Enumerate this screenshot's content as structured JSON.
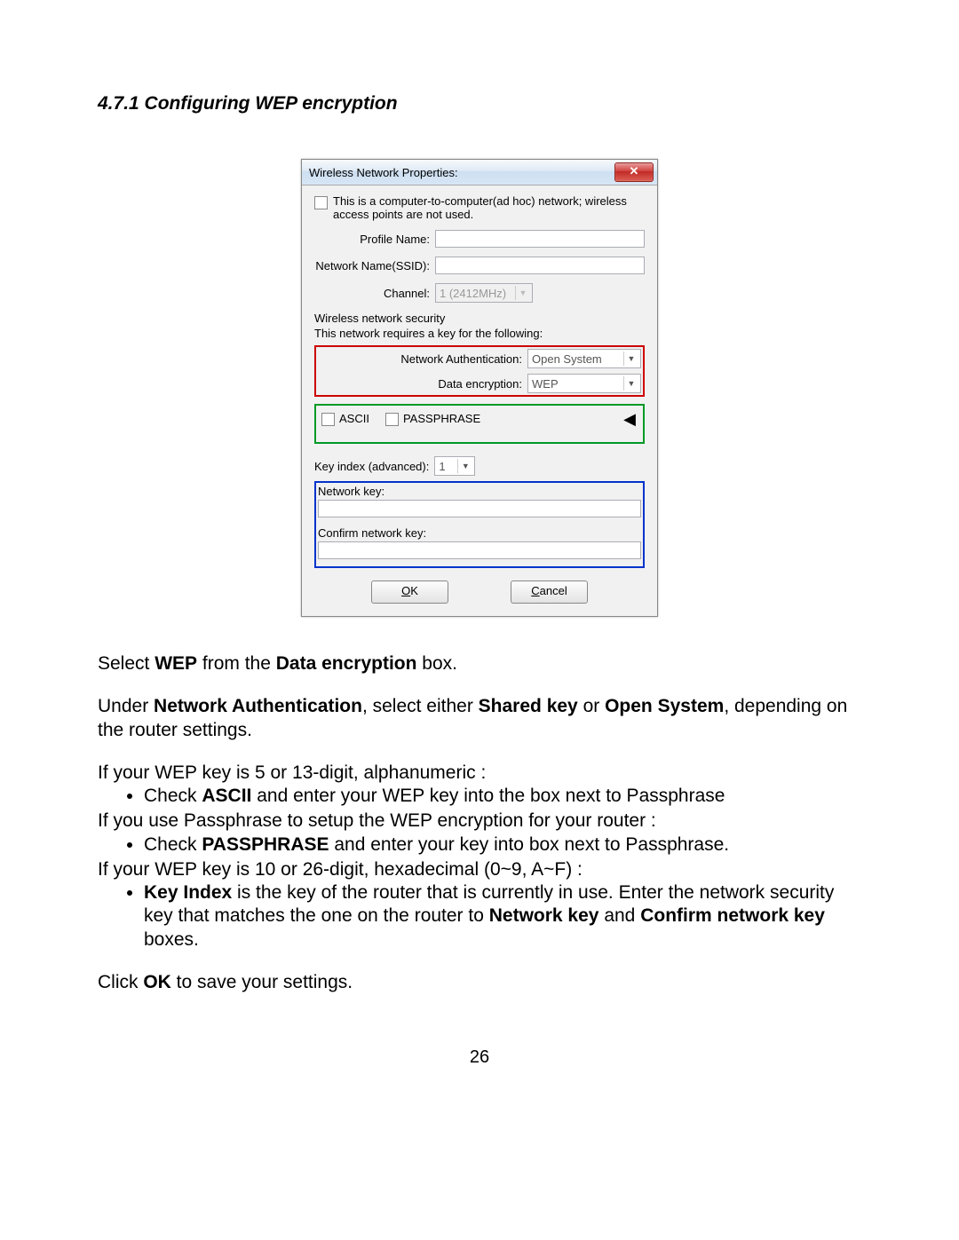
{
  "section_title": "4.7.1 Configuring WEP encryption",
  "dialog": {
    "title": "Wireless Network Properties:",
    "close": "✕",
    "adhoc_text": "This is a computer-to-computer(ad hoc) network; wireless access points are not used.",
    "profile_label": "Profile Name:",
    "ssid_label": "Network Name(SSID):",
    "channel_label": "Channel:",
    "channel_value": "1 (2412MHz)",
    "sec_group": "Wireless network security",
    "sec_sub": "This network requires a key for the following:",
    "auth_label": "Network Authentication:",
    "auth_value": "Open System",
    "enc_label": "Data encryption:",
    "enc_value": "WEP",
    "ascii": "ASCII",
    "passphrase": "PASSPHRASE",
    "key_index_label": "Key index (advanced):",
    "key_index_value": "1",
    "net_key_label": "Network key:",
    "confirm_key_label": "Confirm network key:",
    "ok": "OK",
    "cancel": "Cancel"
  },
  "body": {
    "p1a": "Select ",
    "p1b": "WEP",
    "p1c": " from the ",
    "p1d": "Data encryption",
    "p1e": " box.",
    "p2a": "Under ",
    "p2b": "Network Authentication",
    "p2c": ", select either ",
    "p2d": "Shared key",
    "p2e": " or ",
    "p2f": "Open System",
    "p2g": ", depending on the router settings.",
    "p3": "If your WEP key is 5 or 13-digit, alphanumeric :",
    "b1a": "Check ",
    "b1b": "ASCII",
    "b1c": " and enter your WEP key into the box next to Passphrase",
    "p4": "If you use Passphrase to setup the WEP encryption for your router :",
    "b2a": "Check ",
    "b2b": "PASSPHRASE",
    "b2c": " and enter your key into box next to Passphrase.",
    "p5": "If your WEP key is 10 or 26-digit, hexadecimal (0~9, A~F) :",
    "b3a": "Key Index",
    "b3b": " is the key of the router that is currently in use. Enter the network security key that matches the one on the router to ",
    "b3c": "Network key",
    "b3d": " and ",
    "b3e": "Confirm network key",
    "b3f": " boxes.",
    "p6a": "Click ",
    "p6b": "OK",
    "p6c": " to save your settings."
  },
  "page_number": "26"
}
